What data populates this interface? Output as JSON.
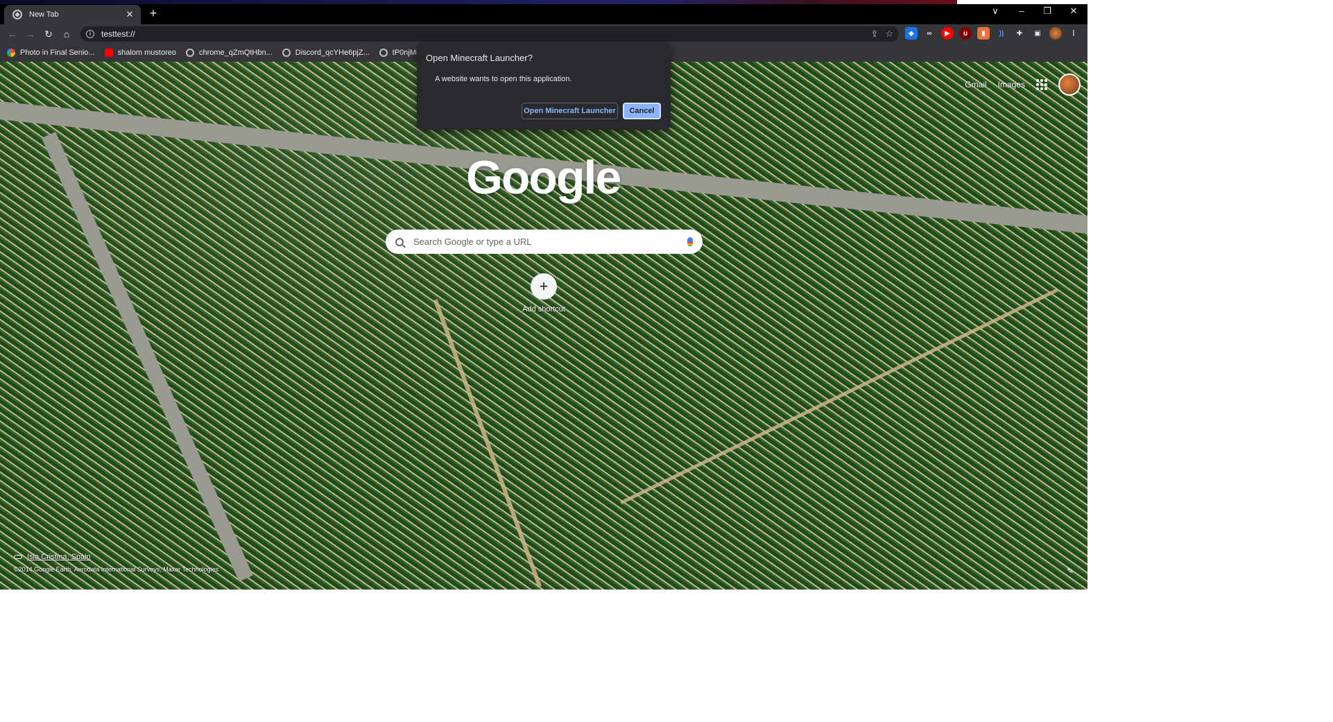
{
  "tab": {
    "title": "New Tab"
  },
  "window_controls": {
    "dropdown": "∨",
    "minimize": "–",
    "restore": "❐",
    "close": "✕"
  },
  "toolbar": {
    "url": "testtest://"
  },
  "bookmarks": [
    {
      "label": "Photo in Final Senio...",
      "icon": "photos-icon"
    },
    {
      "label": "shalom mustoreo",
      "icon": "youtube-icon"
    },
    {
      "label": "chrome_qZmQtHbn...",
      "icon": "globe-icon"
    },
    {
      "label": "Discord_qcYHe6pjZ...",
      "icon": "globe-icon"
    },
    {
      "label": "tP0njMicZm.png (8...",
      "icon": "globe-icon"
    }
  ],
  "top_links": {
    "gmail": "Gmail",
    "images": "Images"
  },
  "google_logo": "Google",
  "search": {
    "placeholder": "Search Google or type a URL"
  },
  "shortcut": {
    "label": "Add shortcut"
  },
  "attribution": {
    "location": "Isla Cristina, Spain",
    "credit": "©2014 Google Earth, Aerodata International Surveys, Maxar Technologies"
  },
  "dialog": {
    "title": "Open Minecraft Launcher?",
    "body": "A website wants to open this application.",
    "open_label": "Open Minecraft Launcher",
    "cancel_label": "Cancel"
  },
  "colors": {
    "accent": "#8ab4f8",
    "toolbar": "#35363a",
    "dialog": "#292a2d"
  }
}
